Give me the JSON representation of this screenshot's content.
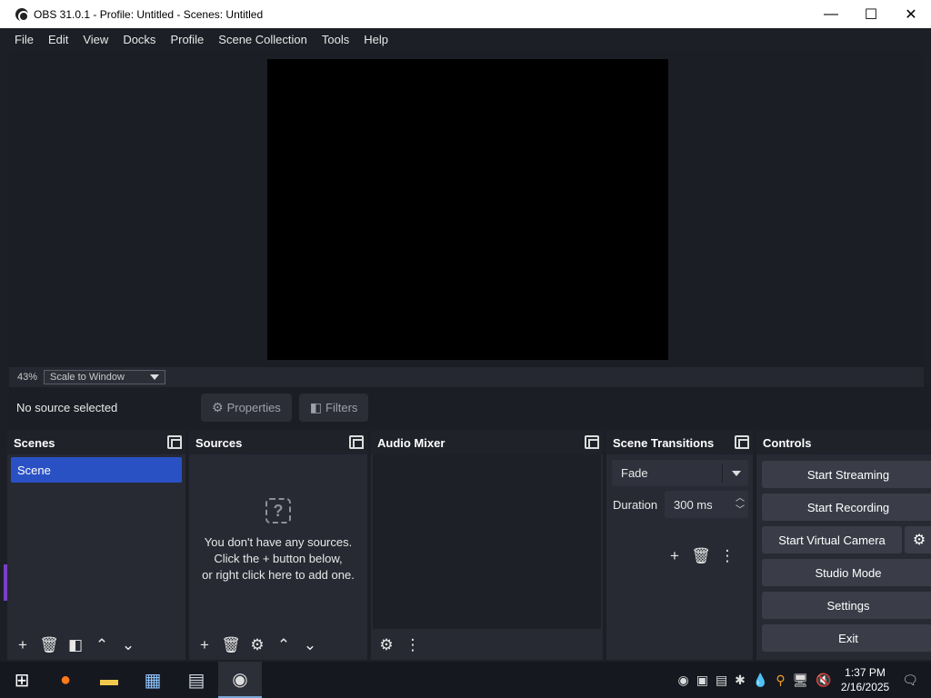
{
  "window": {
    "title": "OBS 31.0.1 - Profile: Untitled - Scenes: Untitled",
    "minimize": "—",
    "maximize": "☐",
    "close": "✕"
  },
  "menu": [
    "File",
    "Edit",
    "View",
    "Docks",
    "Profile",
    "Scene Collection",
    "Tools",
    "Help"
  ],
  "preview": {
    "zoom": "43%",
    "scale_mode": "Scale to Window"
  },
  "source_toolbar": {
    "status": "No source selected",
    "properties_label": "Properties",
    "filters_label": "Filters"
  },
  "docks": {
    "scenes": {
      "title": "Scenes",
      "items": [
        "Scene"
      ]
    },
    "sources": {
      "title": "Sources",
      "empty_lines": [
        "You don't have any sources.",
        "Click the + button below,",
        "or right click here to add one."
      ]
    },
    "audio_mixer": {
      "title": "Audio Mixer"
    },
    "transitions": {
      "title": "Scene Transitions",
      "selected": "Fade",
      "duration_label": "Duration",
      "duration_value": "300 ms"
    },
    "controls": {
      "title": "Controls",
      "start_streaming": "Start Streaming",
      "start_recording": "Start Recording",
      "start_virtual_camera": "Start Virtual Camera",
      "studio_mode": "Studio Mode",
      "settings": "Settings",
      "exit": "Exit"
    }
  },
  "taskbar": {
    "time": "1:37 PM",
    "date": "2/16/2025"
  },
  "colors": {
    "accent": "#2a51c4",
    "background": "#1d1f26",
    "panel": "#272a33"
  }
}
